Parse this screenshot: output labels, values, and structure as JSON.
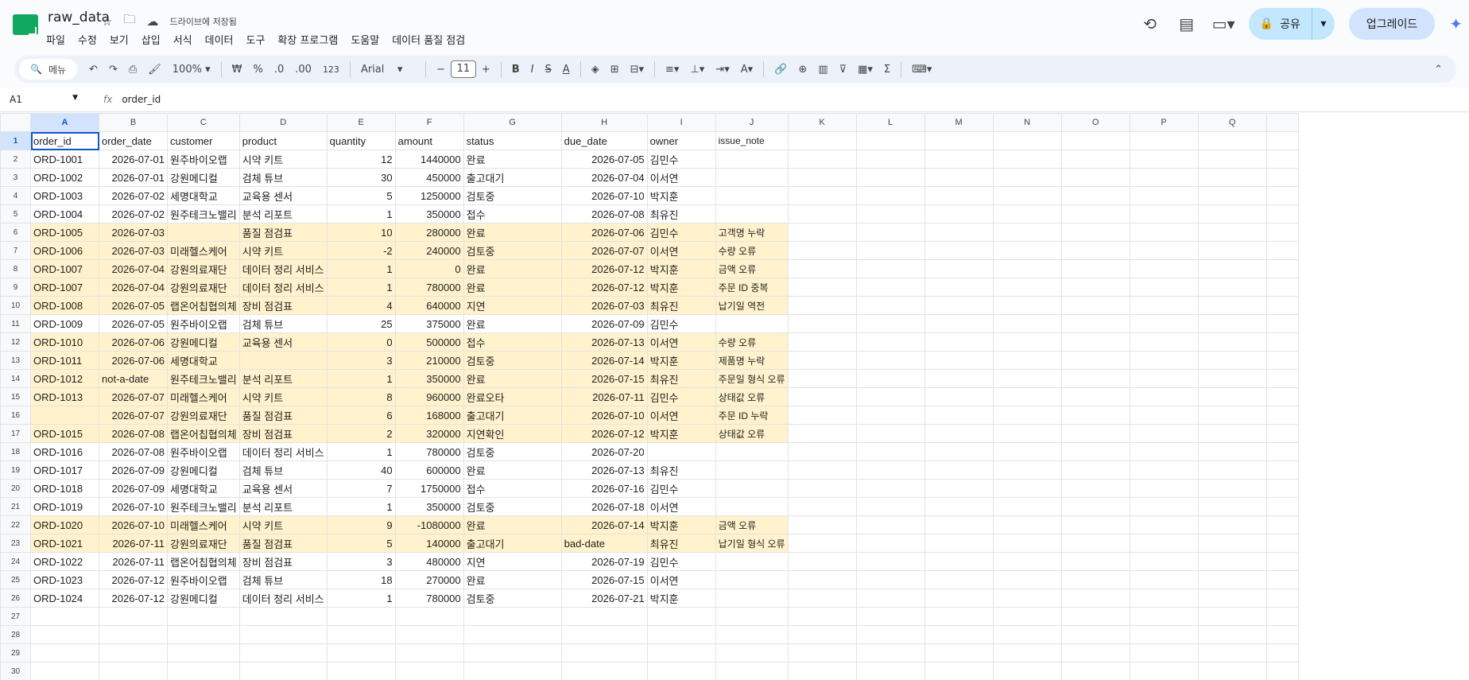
{
  "doc_title": "raw_data",
  "saved_status": "드라이브에 저장됨",
  "menu": [
    "파일",
    "수정",
    "보기",
    "삽입",
    "서식",
    "데이터",
    "도구",
    "확장 프로그램",
    "도움말",
    "데이터 품질 점검"
  ],
  "share_label": "공유",
  "upgrade_label": "업그레이드",
  "toolbar": {
    "search_label": "메뉴",
    "zoom": "100%",
    "currency": "₩",
    "percent": "%",
    "dec_dec": ".0",
    "inc_dec": ".00",
    "format_123": "123",
    "font": "Arial",
    "font_size": "11"
  },
  "namebox": "A1",
  "formula": "order_id",
  "columns": [
    "A",
    "B",
    "C",
    "D",
    "E",
    "F",
    "G",
    "H",
    "I",
    "J",
    "K",
    "L",
    "M",
    "N",
    "O",
    "P",
    "Q"
  ],
  "header_row": [
    "order_id",
    "order_date",
    "customer",
    "product",
    "quantity",
    "amount",
    "status",
    "due_date",
    "owner",
    "issue_note"
  ],
  "rows": [
    {
      "cells": [
        "ORD-1001",
        "2026-07-01",
        "원주바이오랩",
        "시약 키트",
        "12",
        "1440000",
        "완료",
        "2026-07-05",
        "김민수",
        ""
      ],
      "hl": false
    },
    {
      "cells": [
        "ORD-1002",
        "2026-07-01",
        "강원메디컬",
        "검체 튜브",
        "30",
        "450000",
        "출고대기",
        "2026-07-04",
        "이서연",
        ""
      ],
      "hl": false
    },
    {
      "cells": [
        "ORD-1003",
        "2026-07-02",
        "세명대학교",
        "교육용 센서",
        "5",
        "1250000",
        "검토중",
        "2026-07-10",
        "박지훈",
        ""
      ],
      "hl": false
    },
    {
      "cells": [
        "ORD-1004",
        "2026-07-02",
        "원주테크노밸리",
        "분석 리포트",
        "1",
        "350000",
        "접수",
        "2026-07-08",
        "최유진",
        ""
      ],
      "hl": false
    },
    {
      "cells": [
        "ORD-1005",
        "2026-07-03",
        "",
        "품질 점검표",
        "10",
        "280000",
        "완료",
        "2026-07-06",
        "김민수",
        "고객명 누락"
      ],
      "hl": true
    },
    {
      "cells": [
        "ORD-1006",
        "2026-07-03",
        "미래헬스케어",
        "시약 키트",
        "-2",
        "240000",
        "검토중",
        "2026-07-07",
        "이서연",
        "수량 오류"
      ],
      "hl": true
    },
    {
      "cells": [
        "ORD-1007",
        "2026-07-04",
        "강원의료재단",
        "데이터 정리 서비스",
        "1",
        "0",
        "완료",
        "2026-07-12",
        "박지훈",
        "금액 오류"
      ],
      "hl": true
    },
    {
      "cells": [
        "ORD-1007",
        "2026-07-04",
        "강원의료재단",
        "데이터 정리 서비스",
        "1",
        "780000",
        "완료",
        "2026-07-12",
        "박지훈",
        "주문 ID 중복"
      ],
      "hl": true
    },
    {
      "cells": [
        "ORD-1008",
        "2026-07-05",
        "랩온어칩협의체",
        "장비 점검표",
        "4",
        "640000",
        "지연",
        "2026-07-03",
        "최유진",
        "납기일 역전"
      ],
      "hl": true
    },
    {
      "cells": [
        "ORD-1009",
        "2026-07-05",
        "원주바이오랩",
        "검체 튜브",
        "25",
        "375000",
        "완료",
        "2026-07-09",
        "김민수",
        ""
      ],
      "hl": false
    },
    {
      "cells": [
        "ORD-1010",
        "2026-07-06",
        "강원메디컬",
        "교육용 센서",
        "0",
        "500000",
        "접수",
        "2026-07-13",
        "이서연",
        "수량 오류"
      ],
      "hl": true
    },
    {
      "cells": [
        "ORD-1011",
        "2026-07-06",
        "세명대학교",
        "",
        "3",
        "210000",
        "검토중",
        "2026-07-14",
        "박지훈",
        "제품명 누락"
      ],
      "hl": true
    },
    {
      "cells": [
        "ORD-1012",
        "not-a-date",
        "원주테크노밸리",
        "분석 리포트",
        "1",
        "350000",
        "완료",
        "2026-07-15",
        "최유진",
        "주문일 형식 오류"
      ],
      "hl": true
    },
    {
      "cells": [
        "ORD-1013",
        "2026-07-07",
        "미래헬스케어",
        "시약 키트",
        "8",
        "960000",
        "완료오타",
        "2026-07-11",
        "김민수",
        "상태값 오류"
      ],
      "hl": true
    },
    {
      "cells": [
        "",
        "2026-07-07",
        "강원의료재단",
        "품질 점검표",
        "6",
        "168000",
        "출고대기",
        "2026-07-10",
        "이서연",
        "주문 ID 누락"
      ],
      "hl": true
    },
    {
      "cells": [
        "ORD-1015",
        "2026-07-08",
        "랩온어칩협의체",
        "장비 점검표",
        "2",
        "320000",
        "지연확인",
        "2026-07-12",
        "박지훈",
        "상태값 오류"
      ],
      "hl": true
    },
    {
      "cells": [
        "ORD-1016",
        "2026-07-08",
        "원주바이오랩",
        "데이터 정리 서비스",
        "1",
        "780000",
        "검토중",
        "2026-07-20",
        "",
        ""
      ],
      "hl": false
    },
    {
      "cells": [
        "ORD-1017",
        "2026-07-09",
        "강원메디컬",
        "검체 튜브",
        "40",
        "600000",
        "완료",
        "2026-07-13",
        "최유진",
        ""
      ],
      "hl": false
    },
    {
      "cells": [
        "ORD-1018",
        "2026-07-09",
        "세명대학교",
        "교육용 센서",
        "7",
        "1750000",
        "접수",
        "2026-07-16",
        "김민수",
        ""
      ],
      "hl": false
    },
    {
      "cells": [
        "ORD-1019",
        "2026-07-10",
        "원주테크노밸리",
        "분석 리포트",
        "1",
        "350000",
        "검토중",
        "2026-07-18",
        "이서연",
        ""
      ],
      "hl": false
    },
    {
      "cells": [
        "ORD-1020",
        "2026-07-10",
        "미래헬스케어",
        "시약 키트",
        "9",
        "-1080000",
        "완료",
        "2026-07-14",
        "박지훈",
        "금액 오류"
      ],
      "hl": true
    },
    {
      "cells": [
        "ORD-1021",
        "2026-07-11",
        "강원의료재단",
        "품질 점검표",
        "5",
        "140000",
        "출고대기",
        "bad-date",
        "최유진",
        "납기일 형식 오류"
      ],
      "hl": true
    },
    {
      "cells": [
        "ORD-1022",
        "2026-07-11",
        "랩온어칩협의체",
        "장비 점검표",
        "3",
        "480000",
        "지연",
        "2026-07-19",
        "김민수",
        ""
      ],
      "hl": false
    },
    {
      "cells": [
        "ORD-1023",
        "2026-07-12",
        "원주바이오랩",
        "검체 튜브",
        "18",
        "270000",
        "완료",
        "2026-07-15",
        "이서연",
        ""
      ],
      "hl": false
    },
    {
      "cells": [
        "ORD-1024",
        "2026-07-12",
        "강원메디컬",
        "데이터 정리 서비스",
        "1",
        "780000",
        "검토중",
        "2026-07-21",
        "박지훈",
        ""
      ],
      "hl": false
    }
  ],
  "empty_rows": [
    27,
    28,
    29,
    30
  ],
  "colors": {
    "highlight": "#fff2cc",
    "accent": "#0b57d0",
    "share_bg": "#c2e7ff"
  }
}
